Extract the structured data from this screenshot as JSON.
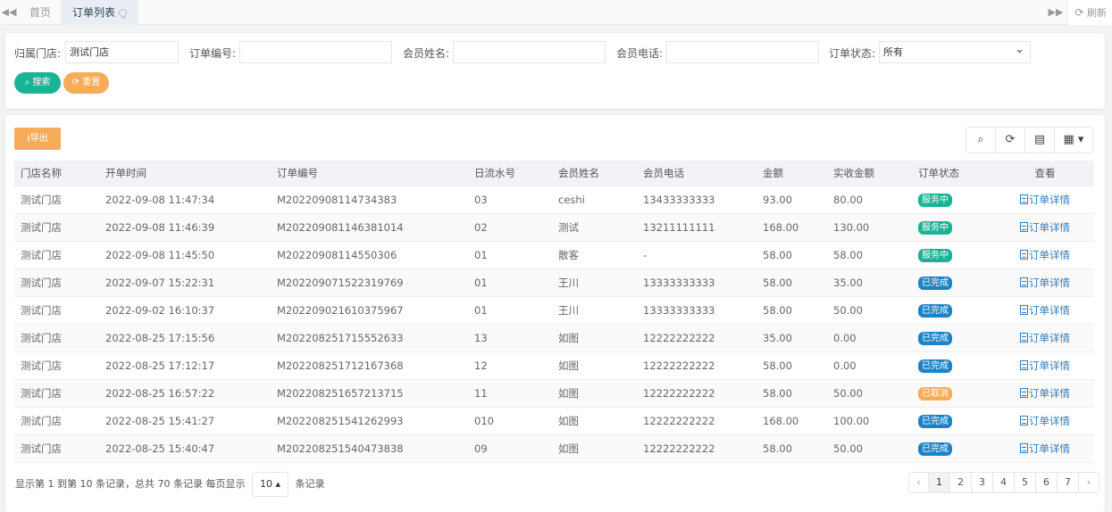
{
  "tabs": {
    "prev_icon": "double-chevron-left",
    "next_icon": "double-chevron-right",
    "items": [
      {
        "label": "首页",
        "active": false
      },
      {
        "label": "订单列表",
        "active": true
      }
    ],
    "refresh_label": "刷新"
  },
  "search": {
    "store_label": "归属门店:",
    "store_value": "测试门店",
    "order_no_label": "订单编号:",
    "order_no_value": "",
    "member_name_label": "会员姓名:",
    "member_name_value": "",
    "member_phone_label": "会员电话:",
    "member_phone_value": "",
    "status_label": "订单状态:",
    "status_value": "所有",
    "search_button": "搜索",
    "reset_button": "重置"
  },
  "table": {
    "export_button": "导出",
    "toolbar_icons": [
      "search-icon",
      "refresh-icon",
      "list-icon",
      "grid-columns-icon"
    ],
    "columns": [
      "门店名称",
      "开单时间",
      "订单编号",
      "日流水号",
      "会员姓名",
      "会员电话",
      "金额",
      "实收金额",
      "订单状态",
      "查看"
    ],
    "rows": [
      {
        "store": "测试门店",
        "time": "2022-09-08 11:47:34",
        "order_no": "M20220908114734383",
        "serial": "03",
        "name": "ceshi",
        "phone": "13433333333",
        "amount": "93.00",
        "paid": "80.00",
        "status": "服务中",
        "status_color": "#1ab394",
        "view": "订单详情"
      },
      {
        "store": "测试门店",
        "time": "2022-09-08 11:46:39",
        "order_no": "M202209081146381014",
        "serial": "02",
        "name": "测试",
        "phone": "13211111111",
        "amount": "168.00",
        "paid": "130.00",
        "status": "服务中",
        "status_color": "#1ab394",
        "view": "订单详情"
      },
      {
        "store": "测试门店",
        "time": "2022-09-08 11:45:50",
        "order_no": "M20220908114550306",
        "serial": "01",
        "name": "散客",
        "phone": "-",
        "amount": "58.00",
        "paid": "58.00",
        "status": "服务中",
        "status_color": "#1ab394",
        "view": "订单详情"
      },
      {
        "store": "测试门店",
        "time": "2022-09-07 15:22:31",
        "order_no": "M202209071522319769",
        "serial": "01",
        "name": "王川",
        "phone": "13333333333",
        "amount": "58.00",
        "paid": "35.00",
        "status": "已完成",
        "status_color": "#1c84c6",
        "view": "订单详情"
      },
      {
        "store": "测试门店",
        "time": "2022-09-02 16:10:37",
        "order_no": "M202209021610375967",
        "serial": "01",
        "name": "王川",
        "phone": "13333333333",
        "amount": "58.00",
        "paid": "50.00",
        "status": "已完成",
        "status_color": "#1c84c6",
        "view": "订单详情"
      },
      {
        "store": "测试门店",
        "time": "2022-08-25 17:15:56",
        "order_no": "M202208251715552633",
        "serial": "13",
        "name": "如图",
        "phone": "12222222222",
        "amount": "35.00",
        "paid": "0.00",
        "status": "已完成",
        "status_color": "#1c84c6",
        "view": "订单详情"
      },
      {
        "store": "测试门店",
        "time": "2022-08-25 17:12:17",
        "order_no": "M202208251712167368",
        "serial": "12",
        "name": "如图",
        "phone": "12222222222",
        "amount": "58.00",
        "paid": "0.00",
        "status": "已完成",
        "status_color": "#1c84c6",
        "view": "订单详情"
      },
      {
        "store": "测试门店",
        "time": "2022-08-25 16:57:22",
        "order_no": "M202208251657213715",
        "serial": "11",
        "name": "如图",
        "phone": "12222222222",
        "amount": "58.00",
        "paid": "50.00",
        "status": "已取消",
        "status_color": "#f8ac59",
        "view": "订单详情"
      },
      {
        "store": "测试门店",
        "time": "2022-08-25 15:41:27",
        "order_no": "M202208251541262993",
        "serial": "010",
        "name": "如图",
        "phone": "12222222222",
        "amount": "168.00",
        "paid": "100.00",
        "status": "已完成",
        "status_color": "#1c84c6",
        "view": "订单详情"
      },
      {
        "store": "测试门店",
        "time": "2022-08-25 15:40:47",
        "order_no": "M202208251540473838",
        "serial": "09",
        "name": "如图",
        "phone": "12222222222",
        "amount": "58.00",
        "paid": "50.00",
        "status": "已完成",
        "status_color": "#1c84c6",
        "view": "订单详情"
      }
    ]
  },
  "footer": {
    "summary": "显示第 1 到第 10 条记录，总共 70 条记录",
    "per_page_prefix": "每页显示",
    "page_size": "10",
    "per_page_suffix": "条记录",
    "pages": [
      "1",
      "2",
      "3",
      "4",
      "5",
      "6",
      "7"
    ],
    "current_page": "1"
  }
}
